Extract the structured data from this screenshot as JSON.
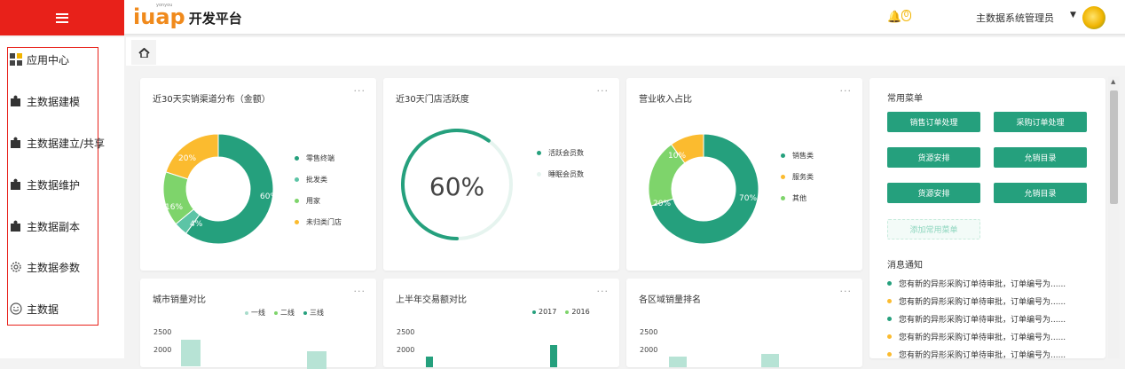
{
  "header": {
    "logo_brand": "iuap",
    "logo_small": "yonyou",
    "logo_sub": "开发平台",
    "notification_count": "0",
    "user_name": "主数据系统管理员"
  },
  "sidebar": {
    "items": [
      {
        "label": "应用中心",
        "icon": "grid-icon"
      },
      {
        "label": "主数据建模",
        "icon": "puzzle-icon"
      },
      {
        "label": "主数据建立/共享",
        "icon": "puzzle-icon"
      },
      {
        "label": "主数据维护",
        "icon": "puzzle-icon"
      },
      {
        "label": "主数据副本",
        "icon": "puzzle-icon"
      },
      {
        "label": "主数据参数",
        "icon": "gear-icon"
      },
      {
        "label": "主数据",
        "icon": "smile-icon"
      }
    ]
  },
  "colors": {
    "primary": "#25a07d",
    "teal": "#5cc4a6",
    "light_green": "#7ed46b",
    "orange": "#fbbb2f",
    "red": "#e8211a"
  },
  "cards": {
    "channel": {
      "title": "近30天实销渠道分布（金额）",
      "more": "···",
      "legend": [
        "零售终端",
        "批发类",
        "用家",
        "未归类门店"
      ],
      "labels": [
        "60%",
        "4%",
        "16%",
        "20%"
      ]
    },
    "activity": {
      "title": "近30天门店活跃度",
      "more": "···",
      "value": "60%",
      "legend": [
        "活跃会员数",
        "睡眠会员数"
      ]
    },
    "revenue": {
      "title": "营业收入占比",
      "more": "···",
      "legend": [
        "销售类",
        "服务类",
        "其他"
      ],
      "labels": [
        "70%",
        "20%",
        "10%"
      ]
    },
    "city": {
      "title": "城市销量对比",
      "more": "···",
      "legend": [
        "一线",
        "二线",
        "三线"
      ],
      "yticks": [
        "2500",
        "2000"
      ]
    },
    "half": {
      "title": "上半年交易额对比",
      "more": "···",
      "legend": [
        "2017",
        "2016"
      ],
      "yticks": [
        "2500",
        "2000"
      ]
    },
    "region": {
      "title": "各区域销量排名",
      "more": "···",
      "yticks": [
        "2500",
        "2000"
      ]
    }
  },
  "quick_menu": {
    "title": "常用菜单",
    "buttons": [
      "销售订单处理",
      "采购订单处理",
      "货源安排",
      "允销目录",
      "货源安排",
      "允销目录"
    ],
    "add_label": "添加常用菜单"
  },
  "messages": {
    "title": "消息通知",
    "items": [
      {
        "text": "您有新的异形采购订单待审批，订单编号为......",
        "color": "#25a07d"
      },
      {
        "text": "您有新的异形采购订单待审批，订单编号为......",
        "color": "#fbbb2f"
      },
      {
        "text": "您有新的异形采购订单待审批，订单编号为......",
        "color": "#25a07d"
      },
      {
        "text": "您有新的异形采购订单待审批，订单编号为......",
        "color": "#fbbb2f"
      },
      {
        "text": "您有新的异形采购订单待审批，订单编号为......",
        "color": "#fbbb2f"
      }
    ]
  },
  "chart_data": [
    {
      "type": "pie",
      "categories": [
        "零售终端",
        "批发类",
        "用家",
        "未归类门店"
      ],
      "values": [
        60,
        4,
        16,
        20
      ]
    },
    {
      "type": "pie",
      "categories": [
        "活跃会员数",
        "睡眠会员数"
      ],
      "values": [
        60,
        40
      ]
    },
    {
      "type": "pie",
      "categories": [
        "销售类",
        "服务类",
        "其他"
      ],
      "values": [
        70,
        20,
        10
      ]
    }
  ]
}
